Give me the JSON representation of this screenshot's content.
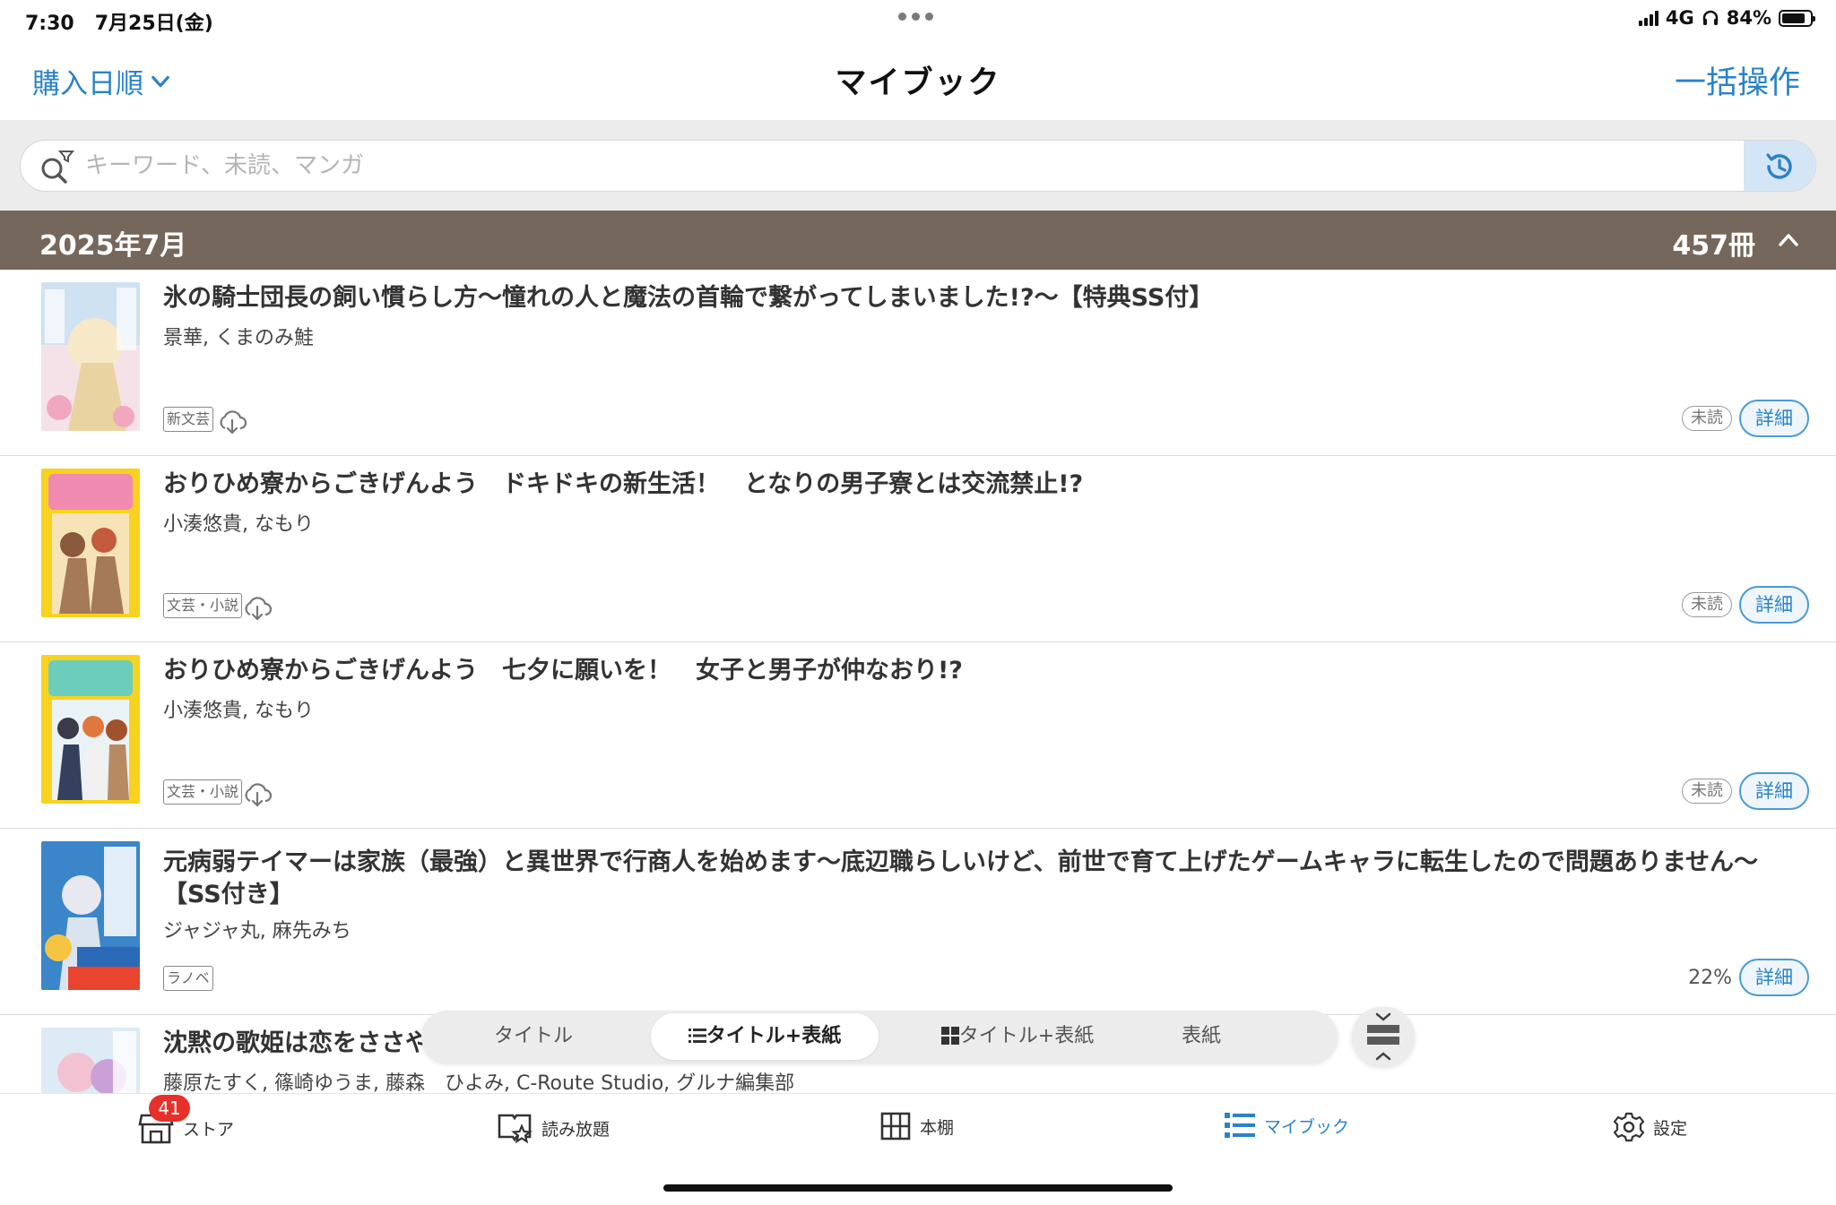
{
  "status_bar": {
    "time": "7:30",
    "date": "7月25日(金)",
    "network": "4G",
    "battery": "84%",
    "battery_level": 0.84
  },
  "header": {
    "sort_label": "購入日順",
    "title": "マイブック",
    "bulk_action": "一括操作"
  },
  "search": {
    "placeholder": "キーワード、未読、マンガ"
  },
  "section": {
    "title": "2025年7月",
    "count": "457冊"
  },
  "books": [
    {
      "title": "氷の騎士団長の飼い慣らし方〜憧れの人と魔法の首輪で繋がってしまいました!?〜【特典SS付】",
      "author": "景華, くまのみ鮭",
      "genre": "新文芸",
      "status": "未読",
      "detail": "詳細",
      "cover_colors": [
        "#f2d6e0",
        "#c8dff0",
        "#f8efe0"
      ]
    },
    {
      "title": "おりひめ寮からごきげんよう　ドキドキの新生活！　となりの男子寮とは交流禁止!?",
      "author": "小湊悠貴, なもり",
      "genre": "文芸・小説",
      "status": "未読",
      "detail": "詳細",
      "cover_colors": [
        "#f7d21e",
        "#f4b7c8",
        "#8b5a3c"
      ]
    },
    {
      "title": "おりひめ寮からごきげんよう　七夕に願いを！　女子と男子が仲なおり!?",
      "author": "小湊悠貴, なもり",
      "genre": "文芸・小説",
      "status": "未読",
      "detail": "詳細",
      "cover_colors": [
        "#f7d21e",
        "#7ed1c0",
        "#e05a5a"
      ]
    },
    {
      "title": "元病弱テイマーは家族（最強）と異世界で行商人を始めます〜底辺職らしいけど、前世で育て上げたゲームキャラに転生したので問題ありません〜【SS付き】",
      "author": "ジャジャ丸, 麻先みち",
      "genre": "ラノベ",
      "progress": "22%",
      "detail": "詳細",
      "cover_colors": [
        "#3a86c9",
        "#e8442e",
        "#f5c542"
      ]
    },
    {
      "title": "沈黙の歌姫は恋をささや",
      "author": "藤原たすく, 篠崎ゆうま, 藤森　ひよみ, C-Route Studio, グルナ編集部",
      "cover_colors": [
        "#cfe6f5",
        "#f3c2d2",
        "#c9a0d8"
      ]
    }
  ],
  "view_switcher": {
    "options": [
      "タイトル",
      "タイトル+表紙",
      "タイトル+表紙",
      "表紙"
    ],
    "selected": "タイトル+表紙"
  },
  "tab_bar": {
    "store": "ストア",
    "store_badge": "41",
    "unlimited": "読み放題",
    "bookshelf": "本棚",
    "mybook": "マイブック",
    "settings": "設定",
    "active": "マイブック"
  },
  "colors": {
    "accent": "#2a82c8",
    "section_bg": "#75675b",
    "badge_red": "#e8302b"
  }
}
